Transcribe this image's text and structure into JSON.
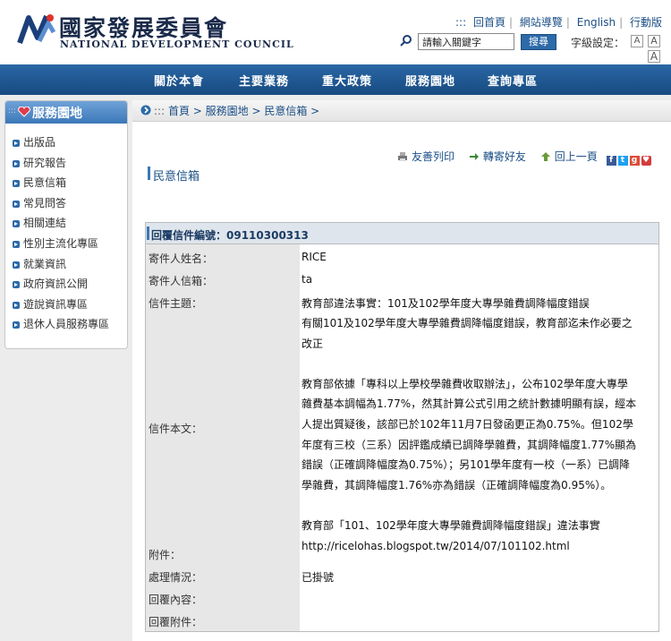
{
  "header": {
    "logo_cn": "國家發展委員會",
    "logo_en": "NATIONAL DEVELOPMENT COUNCIL",
    "top_links": [
      "回首頁",
      "網站導覽",
      "English",
      "行動版"
    ],
    "search_placeholder": "請輸入關鍵字",
    "search_button": "搜尋",
    "font_size_label": "字級設定：",
    "font_size_buttons": [
      "A",
      "A",
      "A"
    ]
  },
  "nav": [
    "關於本會",
    "主要業務",
    "重大政策",
    "服務園地",
    "查詢專區"
  ],
  "sidebar": {
    "title": "服務園地",
    "items": [
      "出版品",
      "研究報告",
      "民意信箱",
      "常見問答",
      "相關連結",
      "性別主流化專區",
      "就業資訊",
      "政府資訊公開",
      "遊說資訊專區",
      "退休人員服務專區"
    ]
  },
  "breadcrumb": "首頁 > 服務園地 > 民意信箱 >",
  "tools": {
    "print": "友善列印",
    "forward": "轉寄好友",
    "back": "回上一頁"
  },
  "page_title": "民意信箱",
  "reply": {
    "title": "回覆信件編號：09110300313",
    "sender_name_label": "寄件人姓名：",
    "sender_name": "RICE",
    "sender_email_label": "寄件人信箱：",
    "sender_email": "ta",
    "subject_label": "信件主題：",
    "subject": "教育部違法事實：101及102學年度大專學雜費調降幅度錯誤",
    "body_label": "信件本文：",
    "body": "有關101及102學年度大專學雜費調降幅度錯誤，教育部迄未作必要之\n改正\n\n教育部依據「專科以上學校學雜費收取辦法」，公布102學年度大專學\n雜費基本調幅為1.77%，然其計算公式引用之統計數據明顯有誤，經本\n人提出質疑後，該部已於102年11月7日發函更正為0.75%。但102學\n年度有三校（三系）因評鑑成績已調降學雜費，其調降幅度1.77%顯為\n錯誤（正確調降幅度為0.75%）；另101學年度有一校（一系）已調降\n學雜費，其調降幅度1.76%亦為錯誤（正確調降幅度為0.95%）。\n\n教育部「101、102學年度大專學雜費調降幅度錯誤」違法事實\nhttp://ricelohas.blogspot.tw/2014/07/101102.html",
    "attachment_label": "附件：",
    "status_label": "處理情況：",
    "status": "已掛號",
    "reply_content_label": "回覆內容：",
    "reply_attachment_label": "回覆附件："
  },
  "colors": {
    "nav": "#1f5a95",
    "accent": "#2c6aa8",
    "label_bg": "#e7e7e7"
  }
}
